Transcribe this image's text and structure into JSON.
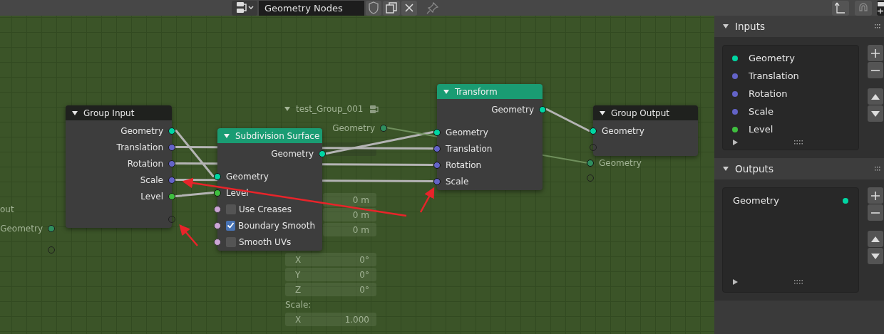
{
  "header": {
    "tree_name": "Geometry Nodes"
  },
  "nodes": [
    {
      "title": "out",
      "kind": "group",
      "ghost": true,
      "rows": [
        {
          "kind": "output",
          "label": "Geometry",
          "color": "#2f8f5f"
        },
        {
          "kind": "empty-out"
        }
      ]
    },
    {
      "title": "Group Input",
      "kind": "group",
      "ghost": false,
      "rows": [
        {
          "kind": "output",
          "label": "Geometry",
          "color": "#00d6a3"
        },
        {
          "kind": "output",
          "label": "Translation",
          "color": "#6363c7"
        },
        {
          "kind": "output",
          "label": "Rotation",
          "color": "#6363c7"
        },
        {
          "kind": "output",
          "label": "Scale",
          "color": "#6363c7"
        },
        {
          "kind": "output",
          "label": "Level",
          "color": "#3fbf3f"
        },
        {
          "kind": "empty-out"
        }
      ]
    },
    {
      "title": "Subdivision Surface",
      "kind": "geometry",
      "ghost": false,
      "rows": [
        {
          "kind": "output",
          "label": "Geometry",
          "color": "#00d6a3"
        },
        {
          "kind": "input",
          "label": "Geometry",
          "color": "#00d6a3",
          "linked": true
        },
        {
          "kind": "input",
          "label": "Level",
          "color": "#3fbf3f",
          "linked": true
        },
        {
          "kind": "checkbox",
          "label": "Use Creases",
          "color": "#cca6d6",
          "checked": false,
          "linked": false
        },
        {
          "kind": "checkbox",
          "label": "Boundary Smooth",
          "color": "#cca6d6",
          "checked": true,
          "linked": false
        },
        {
          "kind": "checkbox",
          "label": "Smooth UVs",
          "color": "#cca6d6",
          "checked": false,
          "linked": false
        }
      ]
    },
    {
      "title": "test_Group_001",
      "kind": "group",
      "ghost": true,
      "rows": [
        {
          "kind": "output",
          "label": "Geometry",
          "color": "#2f8f5f"
        },
        {
          "kind": "selector"
        },
        {
          "kind": "label"
        },
        {
          "kind": "label"
        },
        {
          "kind": "field",
          "value": "0 m"
        },
        {
          "kind": "field",
          "value": "0 m"
        },
        {
          "kind": "field",
          "value": "0 m"
        },
        {
          "kind": "label"
        },
        {
          "kind": "field",
          "label": "X",
          "value": "0°"
        },
        {
          "kind": "field",
          "label": "Y",
          "value": "0°"
        },
        {
          "kind": "field",
          "label": "Z",
          "value": "0°"
        },
        {
          "kind": "label",
          "label": "Scale:"
        },
        {
          "kind": "field",
          "label": "X",
          "value": "1.000"
        }
      ]
    },
    {
      "title": "Transform",
      "kind": "geometry",
      "ghost": false,
      "rows": [
        {
          "kind": "output",
          "label": "Geometry",
          "color": "#00d6a3"
        },
        {
          "kind": "input",
          "label": "Geometry",
          "color": "#00d6a3",
          "linked": true
        },
        {
          "kind": "input",
          "label": "Translation",
          "color": "#6363c7",
          "linked": true
        },
        {
          "kind": "input",
          "label": "Rotation",
          "color": "#6363c7",
          "linked": true
        },
        {
          "kind": "input",
          "label": "Scale",
          "color": "#6363c7",
          "linked": true
        }
      ]
    },
    {
      "title": "Group Output",
      "kind": "group",
      "ghost": false,
      "rows": [
        {
          "kind": "input",
          "label": "Geometry",
          "color": "#00d6a3",
          "linked": true
        },
        {
          "kind": "empty-in"
        }
      ]
    },
    {
      "ghost": true,
      "rows": [
        {
          "kind": "input",
          "label": "Geometry",
          "color": "#2f8f5f",
          "linked": true
        },
        {
          "kind": "empty-in"
        }
      ]
    }
  ],
  "panels": [
    {
      "title": "Inputs",
      "items": [
        {
          "label": "Geometry",
          "color": "#00d6a3"
        },
        {
          "label": "Translation",
          "color": "#6363c7"
        },
        {
          "label": "Rotation",
          "color": "#6363c7"
        },
        {
          "label": "Scale",
          "color": "#6363c7"
        },
        {
          "label": "Level",
          "color": "#3fbf3f"
        }
      ]
    },
    {
      "title": "Outputs",
      "items": [
        {
          "label": "Geometry",
          "color": "#00d6a3"
        }
      ]
    }
  ]
}
